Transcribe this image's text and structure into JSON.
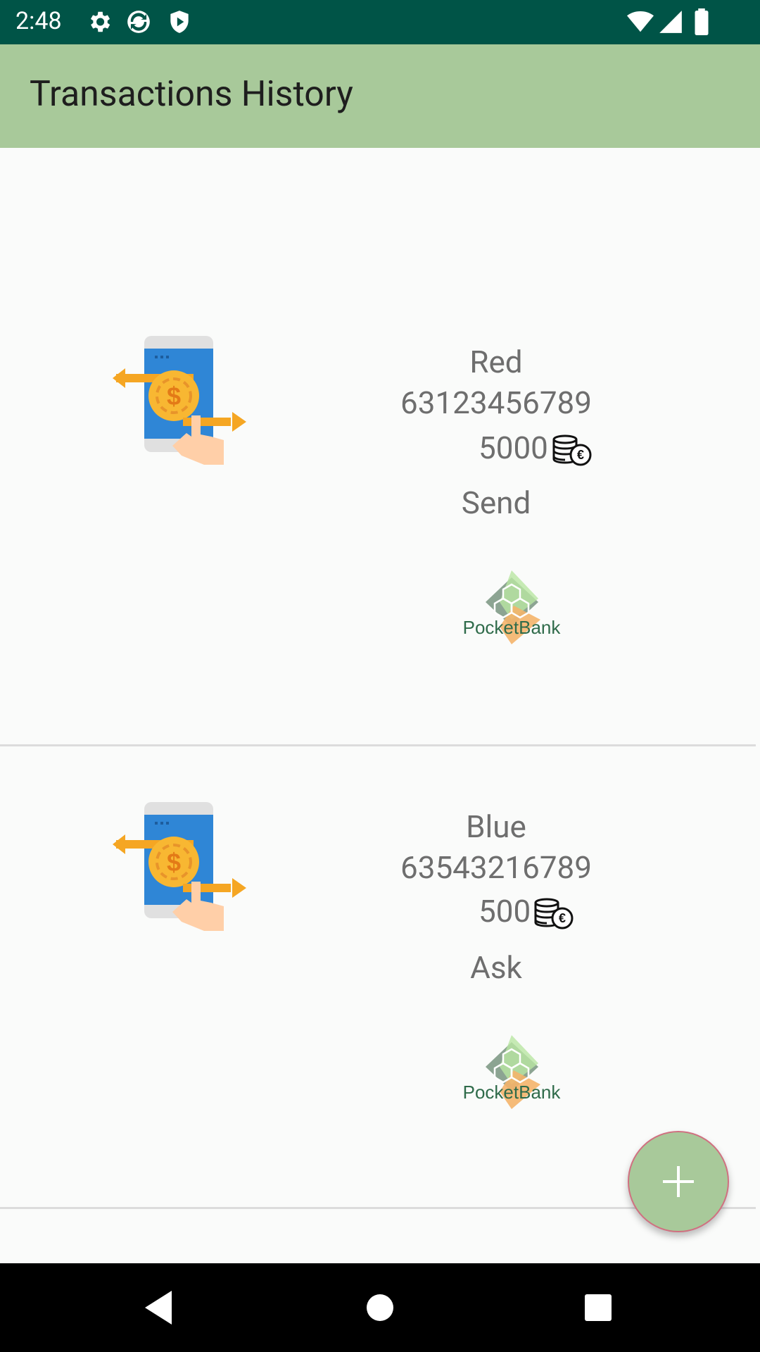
{
  "status_bar": {
    "time": "2:48"
  },
  "app_bar": {
    "title": "Transactions History"
  },
  "transactions": [
    {
      "name": "Red",
      "phone": "63123456789",
      "amount": "5000",
      "type": "Send",
      "logo_text": "PocketBank"
    },
    {
      "name": "Blue",
      "phone": "63543216789",
      "amount": "500",
      "type": "Ask",
      "logo_text": "PocketBank"
    }
  ],
  "icons": {
    "status": [
      "settings-icon",
      "sync-icon",
      "shield-icon",
      "wifi-icon",
      "signal-icon",
      "battery-icon"
    ],
    "transaction": "phone-money-transfer-icon",
    "currency": "euro-coins-icon",
    "fab": "plus-icon",
    "nav": [
      "back-icon",
      "home-icon",
      "recents-icon"
    ]
  },
  "colors": {
    "status_bar": "#005447",
    "app_bar": "#a8c99a",
    "fab": "#a8c99a",
    "text": "#6e6e6e"
  }
}
